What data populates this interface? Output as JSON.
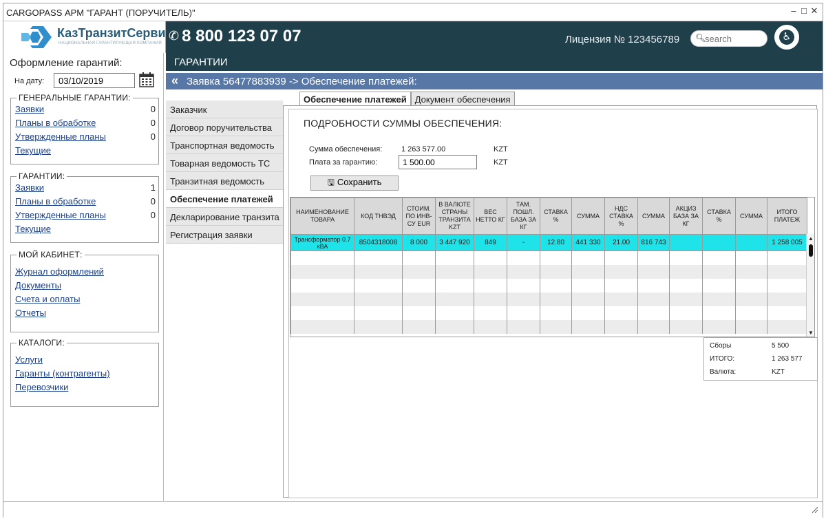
{
  "window": {
    "title": "CARGOPASS АРМ \"ГАРАНТ (ПОРУЧИТЕЛЬ)\"",
    "controls": [
      "‒",
      "□",
      "✕"
    ]
  },
  "header": {
    "logo_name": "КазТранзитСервис",
    "logo_sub": "НАЦИОНАЛЬНАЯ ГАРАНТИРУЮЩАЯ КОМПАНИЯ",
    "phone": "8 800 123 07 07",
    "license": "Лицензия № 123456789",
    "search_placeholder": "search",
    "accent": "#1f3f4a"
  },
  "left": {
    "heading": "Оформление гарантий:",
    "date_label": "На дату:",
    "date_value": "03/10/2019",
    "groups": [
      {
        "legend": "ГЕНЕРАЛЬНЫЕ ГАРАНТИИ:",
        "items": [
          {
            "label": "Заявки",
            "count": "0"
          },
          {
            "label": "Планы в обработке",
            "count": "0"
          },
          {
            "label": "Утвержденные планы",
            "count": "0"
          },
          {
            "label": "Текущие",
            "count": ""
          }
        ]
      },
      {
        "legend": "ГАРАНТИИ:",
        "items": [
          {
            "label": "Заявки",
            "count": "1"
          },
          {
            "label": "Планы в обработке",
            "count": "0"
          },
          {
            "label": "Утвержденные планы",
            "count": "0"
          },
          {
            "label": "Текущие",
            "count": ""
          }
        ]
      },
      {
        "legend": "МОЙ КАБИНЕТ:",
        "items": [
          {
            "label": "Журнал оформлений",
            "count": ""
          },
          {
            "label": "Документы",
            "count": ""
          },
          {
            "label": "Счета и оплаты",
            "count": ""
          },
          {
            "label": "Отчеты",
            "count": ""
          }
        ]
      },
      {
        "legend": "КАТАЛОГИ:",
        "items": [
          {
            "label": "Услуги",
            "count": ""
          },
          {
            "label": "Гаранты (контрагенты)",
            "count": ""
          },
          {
            "label": "Перевозчики",
            "count": ""
          }
        ]
      }
    ]
  },
  "main": {
    "title": "ГАРАНТИИ",
    "breadcrumb": "Заявка 56477883939 -> Обеспечение платежей:",
    "back_icon": "«",
    "nav": [
      "Заказчик",
      "Договор поручительства",
      "Транспортная ведомость",
      "Товарная ведомость ТС",
      "Транзитная ведомость",
      "Обеспечение платежей",
      "Декларирование транзита",
      "Регистрация заявки"
    ],
    "nav_active": 5,
    "tabs": [
      "Обеспечение платежей",
      "Документ обеспечения"
    ],
    "tab_active": 0,
    "section_title": "ПОДРОБНОСТИ СУММЫ ОБЕСПЕЧЕНИЯ:",
    "fields": {
      "sum_label": "Сумма обеспечения:",
      "sum_value": "1 263 577.00",
      "sum_currency": "KZT",
      "fee_label": "Плата за гарантию:",
      "fee_value": "1 500.00",
      "fee_currency": "KZT"
    },
    "save_label": "Сохранить",
    "table": {
      "columns": [
        "НАИМЕНОВАНИЕ ТОВАРА",
        "КОД ТНВЭД",
        "СТОИМ. ПО ИНВ-СУ EUR",
        "В ВАЛЮТЕ СТРАНЫ ТРАНЗИТА KZT",
        "ВЕС НЕТТО КГ",
        "ТАМ. ПОШЛ. БАЗА ЗА КГ",
        "СТАВКА %",
        "СУММА",
        "НДС СТАВКА %",
        "СУММА",
        "АКЦИЗ БАЗА ЗА КГ",
        "СТАВКА %",
        "СУММА",
        "ИТОГО ПЛАТЕЖ"
      ],
      "rows": [
        [
          "Трансформатор 0.7 кВА",
          "8504318008",
          "8 000",
          "3 447 920",
          "849",
          "-",
          "12.80",
          "441 330",
          "21.00",
          "816 743",
          "",
          "",
          "",
          "1 258 005"
        ]
      ],
      "empty_rows": 6,
      "highlight_color": "#1ee3e9"
    },
    "totals": [
      {
        "label": "Сборы",
        "value": "5 500"
      },
      {
        "label": "ИТОГО:",
        "value": "1 263 577"
      },
      {
        "label": "Валюта:",
        "value": "KZT"
      }
    ]
  }
}
